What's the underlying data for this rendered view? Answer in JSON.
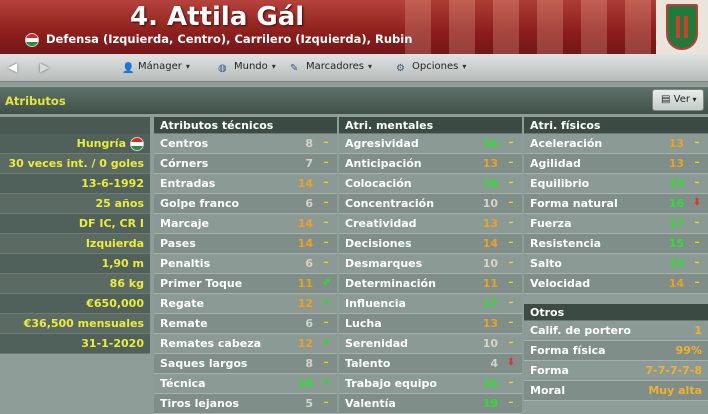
{
  "header": {
    "title": "4. Attila Gál",
    "subtitle": "Defensa (Izquierda, Centro), Carrilero (Izquierda), Rubin"
  },
  "nav": {
    "items": [
      {
        "label": "Mánager",
        "icon": "user-icon"
      },
      {
        "label": "Mundo",
        "icon": "globe-icon"
      },
      {
        "label": "Marcadores",
        "icon": "pen-icon"
      },
      {
        "label": "Opciones",
        "icon": "gears-icon"
      }
    ]
  },
  "section": {
    "title": "Atributos",
    "view_button": "Ver"
  },
  "profile": [
    "Hungría",
    "30 veces int. / 0 goles",
    "13-6-1992",
    "25 años",
    "DF IC, CR I",
    "Izquierda",
    "1,90 m",
    "86 kg",
    "€650,000",
    "€36,500 mensuales",
    "31-1-2020"
  ],
  "technical": {
    "title": "Atributos técnicos",
    "rows": [
      {
        "name": "Centros",
        "value": "8",
        "trend": "flat"
      },
      {
        "name": "Córners",
        "value": "7",
        "trend": "flat"
      },
      {
        "name": "Entradas",
        "value": "14",
        "trend": "flat"
      },
      {
        "name": "Golpe franco",
        "value": "6",
        "trend": "flat"
      },
      {
        "name": "Marcaje",
        "value": "14",
        "trend": "flat"
      },
      {
        "name": "Pases",
        "value": "14",
        "trend": "flat"
      },
      {
        "name": "Penaltis",
        "value": "6",
        "trend": "flat"
      },
      {
        "name": "Primer Toque",
        "value": "11",
        "trend": "up"
      },
      {
        "name": "Regate",
        "value": "12",
        "trend": "up"
      },
      {
        "name": "Remate",
        "value": "6",
        "trend": "flat"
      },
      {
        "name": "Remates cabeza",
        "value": "12",
        "trend": "up"
      },
      {
        "name": "Saques largos",
        "value": "8",
        "trend": "flat"
      },
      {
        "name": "Técnica",
        "value": "16",
        "trend": "up"
      },
      {
        "name": "Tiros lejanos",
        "value": "5",
        "trend": "flat"
      }
    ]
  },
  "mental": {
    "title": "Atri. mentales",
    "rows": [
      {
        "name": "Agresividad",
        "value": "16",
        "trend": "flat"
      },
      {
        "name": "Anticipación",
        "value": "13",
        "trend": "flat"
      },
      {
        "name": "Colocación",
        "value": "16",
        "trend": "flat"
      },
      {
        "name": "Concentración",
        "value": "10",
        "trend": "flat"
      },
      {
        "name": "Creatividad",
        "value": "13",
        "trend": "flat"
      },
      {
        "name": "Decisiones",
        "value": "14",
        "trend": "flat"
      },
      {
        "name": "Desmarques",
        "value": "10",
        "trend": "flat"
      },
      {
        "name": "Determinación",
        "value": "11",
        "trend": "flat"
      },
      {
        "name": "Influencia",
        "value": "17",
        "trend": "flat"
      },
      {
        "name": "Lucha",
        "value": "13",
        "trend": "flat"
      },
      {
        "name": "Serenidad",
        "value": "10",
        "trend": "flat"
      },
      {
        "name": "Talento",
        "value": "4",
        "trend": "down"
      },
      {
        "name": "Trabajo equipo",
        "value": "16",
        "trend": "flat"
      },
      {
        "name": "Valentía",
        "value": "19",
        "trend": "flat"
      }
    ]
  },
  "physical": {
    "title": "Atri. físicos",
    "rows": [
      {
        "name": "Aceleración",
        "value": "13",
        "trend": "flat"
      },
      {
        "name": "Agilidad",
        "value": "13",
        "trend": "flat"
      },
      {
        "name": "Equilibrio",
        "value": "15",
        "trend": "flat"
      },
      {
        "name": "Forma natural",
        "value": "16",
        "trend": "down"
      },
      {
        "name": "Fuerza",
        "value": "17",
        "trend": "flat"
      },
      {
        "name": "Resistencia",
        "value": "15",
        "trend": "flat"
      },
      {
        "name": "Salto",
        "value": "15",
        "trend": "flat"
      },
      {
        "name": "Velocidad",
        "value": "14",
        "trend": "flat"
      }
    ]
  },
  "others": {
    "title": "Otros",
    "rows": [
      {
        "name": "Calif. de portero",
        "value": "1"
      },
      {
        "name": "Forma física",
        "value": "99%"
      },
      {
        "name": "Forma",
        "value": "7-7-7-7-8"
      },
      {
        "name": "Moral",
        "value": "Muy alta"
      }
    ]
  },
  "colors": {
    "high": "#2ee02e",
    "mid": "#f0a020",
    "low": "#d8d2c8",
    "accent": "#e5e63a"
  }
}
